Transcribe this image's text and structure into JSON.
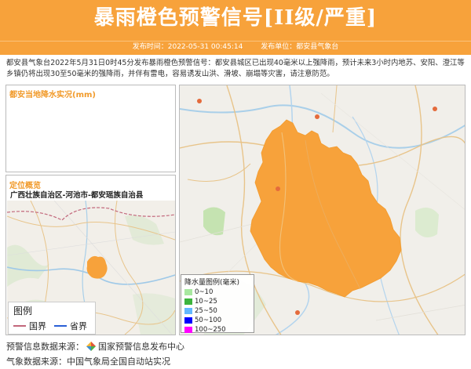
{
  "header": {
    "title": "暴雨橙色预警信号[II级/严重]",
    "publish_time_label": "发布时间：2022-05-31 00:45:14",
    "publisher_label": "发布单位：都安县气象台"
  },
  "description": "都安县气象台2022年5月31日0时45分发布暴雨橙色预警信号：都安县城区已出现40毫米以上强降雨，预计未来3小时内地苏、安阳、澄江等乡镇仍将出现30至50毫米的强降雨，并伴有雷电，容易诱发山洪、滑坡、崩塌等灾害，请注意防范。",
  "rain_panel": {
    "title": "都安当地降水实况(mm)"
  },
  "locate_panel": {
    "title": "定位概览",
    "region": "广西壮族自治区-河池市-都安瑶族自治县"
  },
  "map_legend": {
    "title": "图例",
    "items": [
      {
        "label": "国界",
        "color": "#c2677b"
      },
      {
        "label": "省界",
        "color": "#2a5fd6"
      }
    ]
  },
  "rain_legend": {
    "title": "降水量图例(毫米)",
    "items": [
      {
        "label": "0~10",
        "color": "#a8e8a0"
      },
      {
        "label": "10~25",
        "color": "#3cb43c"
      },
      {
        "label": "25~50",
        "color": "#62b8ff"
      },
      {
        "label": "50~100",
        "color": "#0000ff"
      },
      {
        "label": "100~250",
        "color": "#ff00ff"
      }
    ]
  },
  "footer": {
    "warning_source_label": "预警信息数据来源：",
    "warning_source_name": "国家预警信息发布中心",
    "weather_source": "气象数据来源：中国气象局全国自动站实况"
  },
  "colors": {
    "accent": "#f7a23b",
    "warning_area": "#f7a23b"
  }
}
